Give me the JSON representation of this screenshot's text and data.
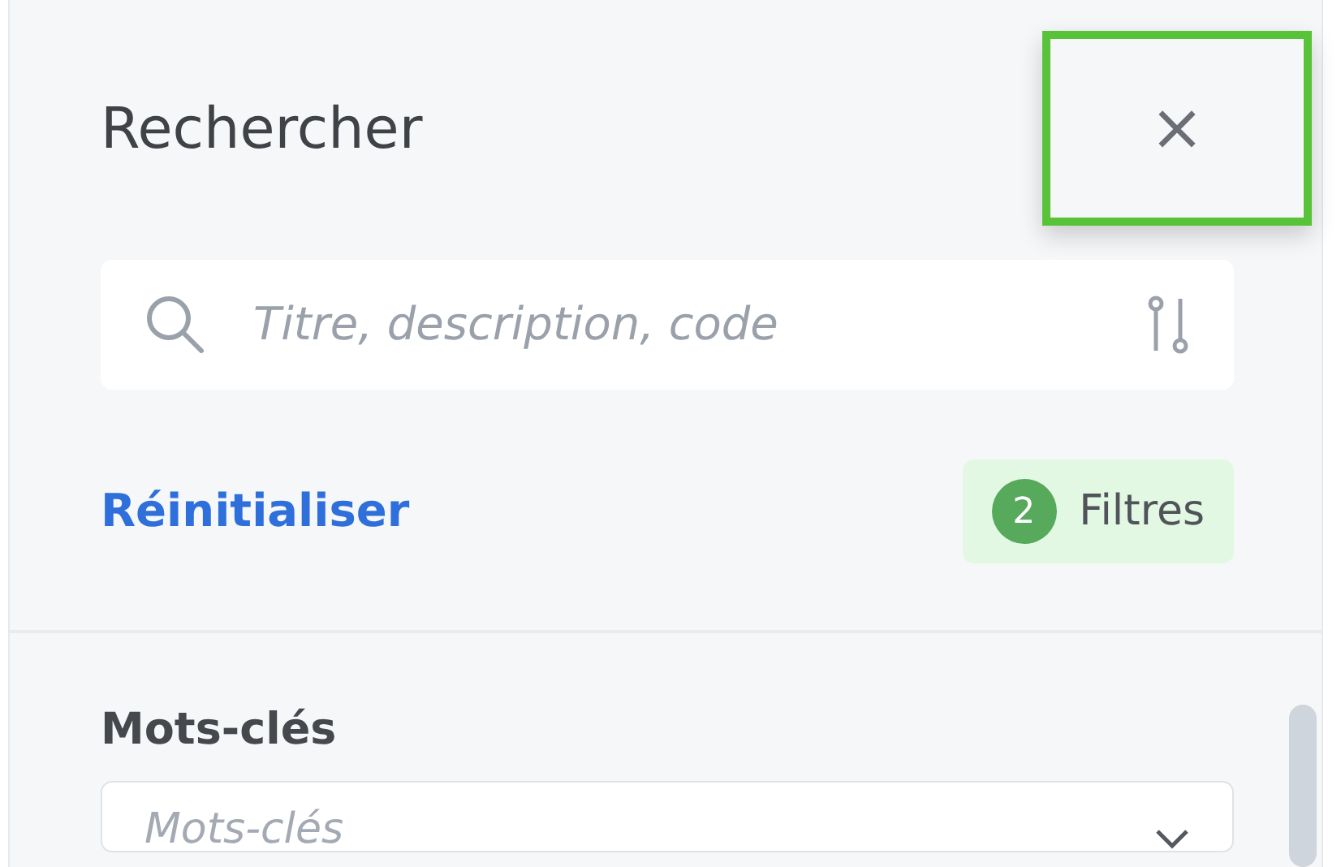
{
  "panel": {
    "title": "Rechercher",
    "close": {
      "symbol": "×",
      "highlighted": true
    }
  },
  "search": {
    "placeholder": "Titre, description, code"
  },
  "reset_link": "Réinitialiser",
  "filters_badge": {
    "count": "2",
    "label": "Filtres"
  },
  "fields": [
    {
      "label": "Mots-clés",
      "placeholder": "Mots-clés"
    }
  ]
}
